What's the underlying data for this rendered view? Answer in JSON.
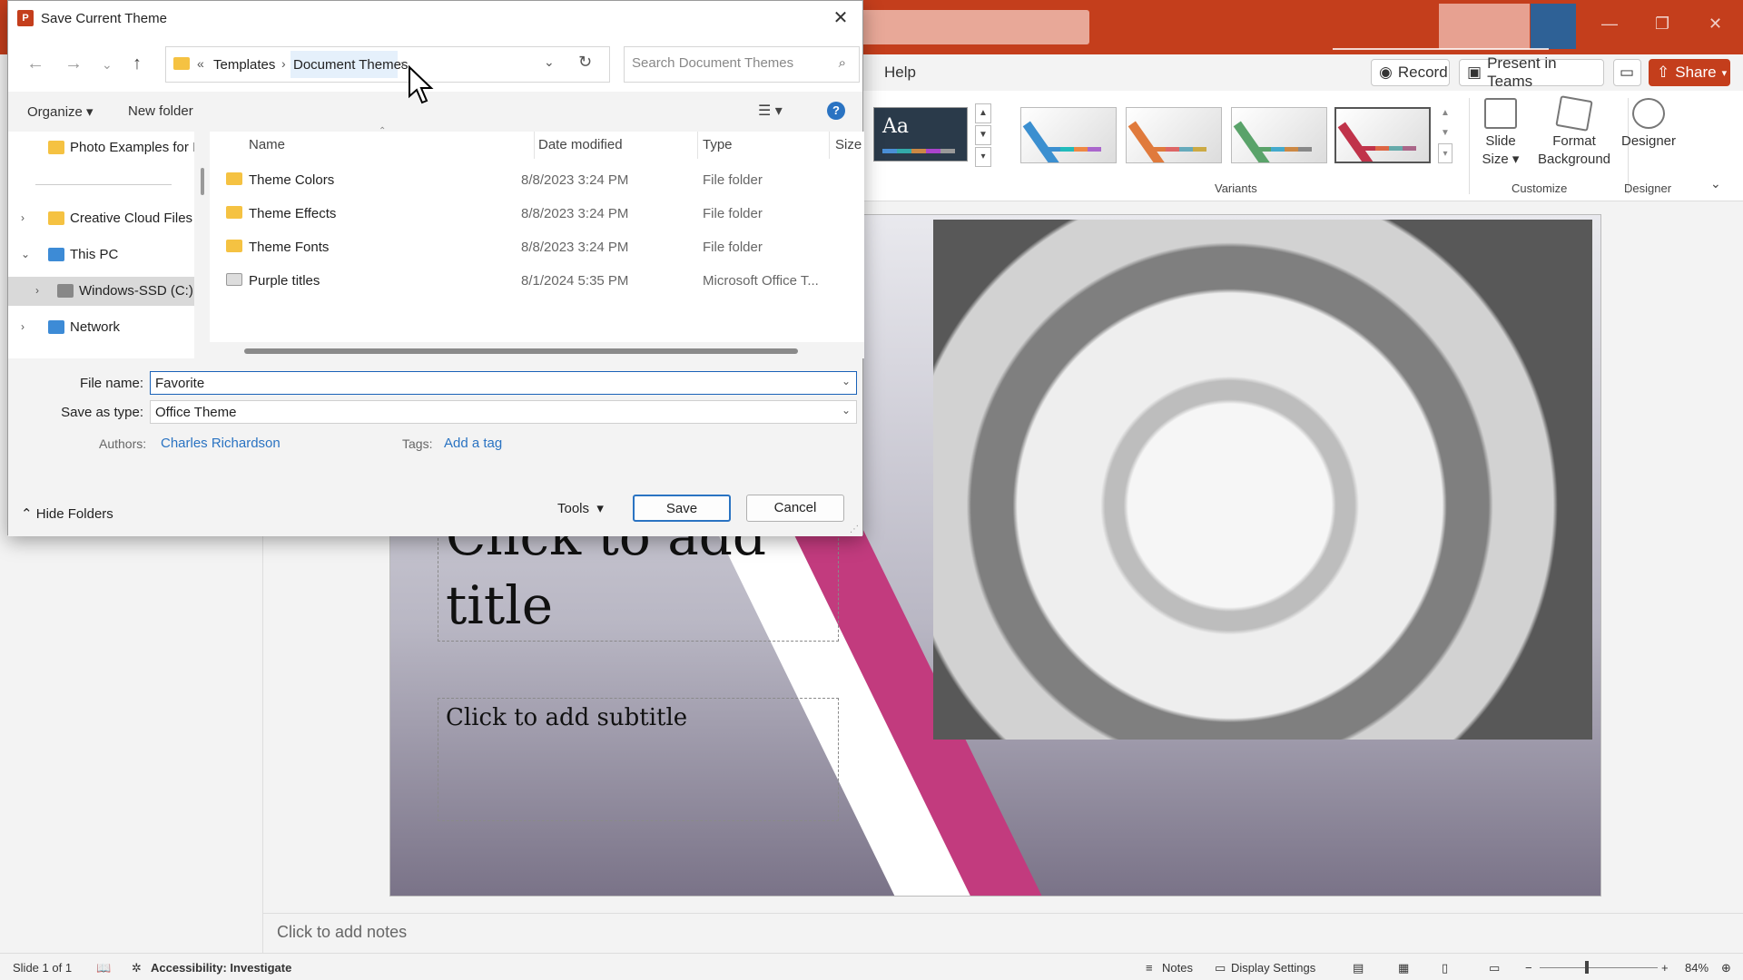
{
  "app": {
    "help_tab": "Help",
    "record_label": "Record",
    "present_teams_label": "Present in Teams",
    "share_label": "Share",
    "ribbon": {
      "variants_label": "Variants",
      "customize_label": "Customize",
      "designer_group_label": "Designer",
      "slide_size_label": "Slide Size",
      "format_background_label": "Format Background",
      "designer_button_label": "Designer",
      "theme_thumb_text": "Aa"
    },
    "slide": {
      "title_placeholder": "Click to add title",
      "subtitle_placeholder": "Click to add subtitle"
    },
    "notes_placeholder": "Click to add notes",
    "status": {
      "slide_counter": "Slide 1 of 1",
      "accessibility": "Accessibility: Investigate",
      "notes_label": "Notes",
      "display_settings_label": "Display Settings",
      "zoom": "84%"
    },
    "colors": {
      "accent": "#c43e1c",
      "slide_stripe": "#c23b7e",
      "link": "#2a73c2"
    }
  },
  "dialog": {
    "title": "Save Current Theme",
    "breadcrumb": {
      "overflow": "«",
      "items": [
        "Templates",
        "Document Themes"
      ]
    },
    "search_placeholder": "Search Document Themes",
    "toolbar": {
      "organize_label": "Organize",
      "new_folder_label": "New folder",
      "help_label": "?"
    },
    "nav_items": [
      {
        "label": "Photo Examples for I",
        "icon": "folder-icon"
      },
      {
        "label": "Creative Cloud Files",
        "icon": "creative-cloud-icon"
      },
      {
        "label": "This PC",
        "icon": "computer-icon"
      },
      {
        "label": "Windows-SSD (C:)",
        "icon": "drive-icon"
      },
      {
        "label": "Network",
        "icon": "network-icon"
      }
    ],
    "columns": [
      "Name",
      "Date modified",
      "Type",
      "Size"
    ],
    "files": [
      {
        "name": "Theme Colors",
        "date": "8/8/2023 3:24 PM",
        "type": "File folder",
        "icon": "folder-icon"
      },
      {
        "name": "Theme Effects",
        "date": "8/8/2023 3:24 PM",
        "type": "File folder",
        "icon": "folder-icon"
      },
      {
        "name": "Theme Fonts",
        "date": "8/8/2023 3:24 PM",
        "type": "File folder",
        "icon": "folder-icon"
      },
      {
        "name": "Purple titles",
        "date": "8/1/2024 5:35 PM",
        "type": "Microsoft Office T...",
        "icon": "theme-file-icon"
      }
    ],
    "form": {
      "file_name_label": "File name:",
      "file_name_value": "Favorite",
      "save_as_type_label": "Save as type:",
      "save_as_type_value": "Office Theme",
      "authors_label": "Authors:",
      "authors_value": "Charles Richardson",
      "tags_label": "Tags:",
      "tags_value": "Add a tag"
    },
    "buttons": {
      "hide_folders": "Hide Folders",
      "tools": "Tools",
      "save": "Save",
      "cancel": "Cancel"
    }
  }
}
